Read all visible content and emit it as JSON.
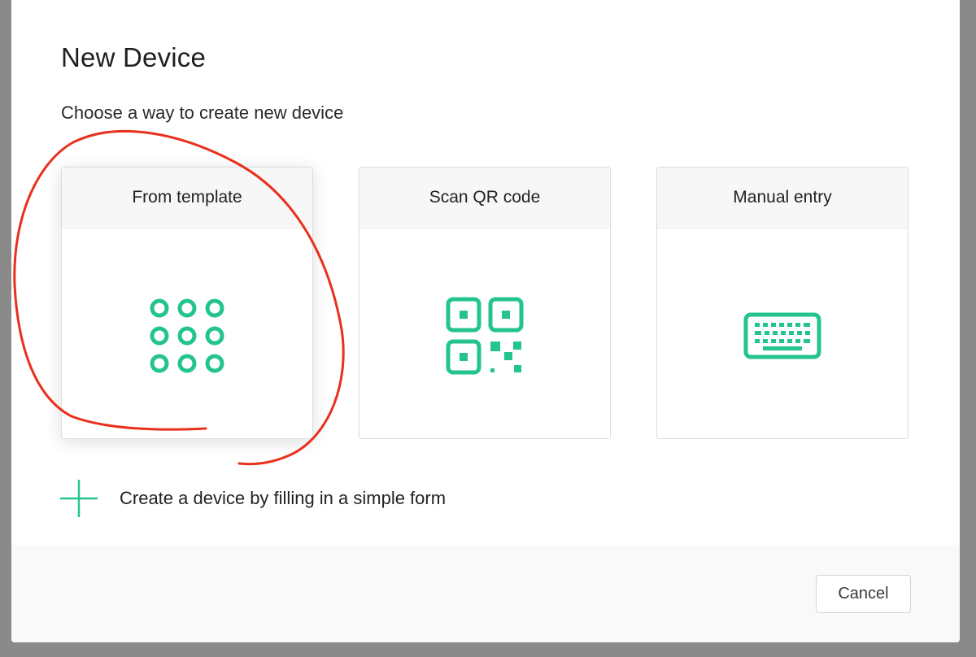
{
  "dialog": {
    "title": "New Device",
    "subtitle": "Choose a way to create new device"
  },
  "options": [
    {
      "label": "From template",
      "icon": "grid-dots-icon",
      "selected": true
    },
    {
      "label": "Scan QR code",
      "icon": "qr-code-icon",
      "selected": false
    },
    {
      "label": "Manual entry",
      "icon": "keyboard-icon",
      "selected": false
    }
  ],
  "form_link": {
    "label": "Create a device by filling in a simple form",
    "icon": "plus-icon"
  },
  "footer": {
    "cancel_label": "Cancel"
  },
  "colors": {
    "accent": "#23c48e",
    "annotation": "#e8301c",
    "backdrop": "#8a8a8a"
  }
}
